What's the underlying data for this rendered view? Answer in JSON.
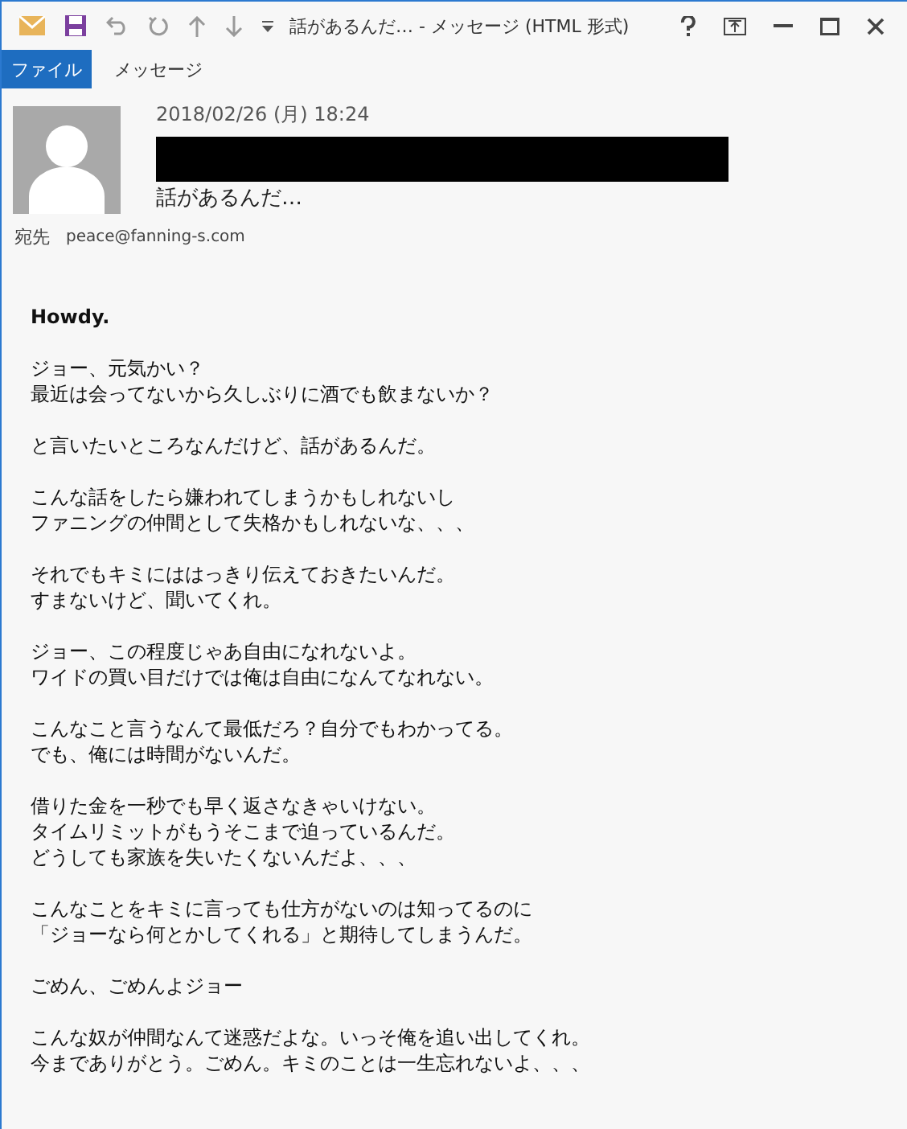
{
  "window": {
    "title": "話があるんだ… - メッセージ (HTML 形式)"
  },
  "tabs": [
    {
      "label": "ファイル",
      "selected": true
    },
    {
      "label": "メッセージ",
      "selected": false
    }
  ],
  "header": {
    "date": "2018/02/26 (月) 18:24",
    "subject": "話があるんだ…",
    "to_label": "宛先",
    "to": "peace@fanning-s.com"
  },
  "body": [
    [
      "Howdy."
    ],
    [
      "ジョー、元気かい？",
      "最近は会ってないから久しぶりに酒でも飲まないか？"
    ],
    [
      "と言いたいところなんだけど、話があるんだ。"
    ],
    [
      "こんな話をしたら嫌われてしまうかもしれないし",
      "ファニングの仲間として失格かもしれないな、、、"
    ],
    [
      "それでもキミにははっきり伝えておきたいんだ。",
      "すまないけど、聞いてくれ。"
    ],
    [
      "ジョー、この程度じゃあ自由になれないよ。",
      "ワイドの買い目だけでは俺は自由になんてなれない。"
    ],
    [
      "こんなこと言うなんて最低だろ？自分でもわかってる。",
      "でも、俺には時間がないんだ。"
    ],
    [
      "借りた金を一秒でも早く返さなきゃいけない。",
      "タイムリミットがもうそこまで迫っているんだ。",
      "どうしても家族を失いたくないんだよ、、、"
    ],
    [
      "こんなことをキミに言っても仕方がないのは知ってるのに",
      "「ジョーなら何とかしてくれる」と期待してしまうんだ。"
    ],
    [
      "ごめん、ごめんよジョー"
    ],
    [
      "こんな奴が仲間なんて迷惑だよな。いっそ俺を追い出してくれ。",
      "今までありがとう。ごめん。キミのことは一生忘れないよ、、、"
    ]
  ]
}
